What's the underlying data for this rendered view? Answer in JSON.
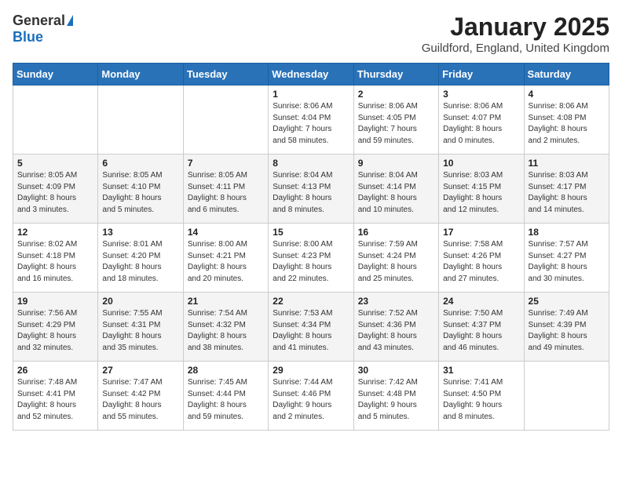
{
  "header": {
    "logo_general": "General",
    "logo_blue": "Blue",
    "month": "January 2025",
    "location": "Guildford, England, United Kingdom"
  },
  "days_of_week": [
    "Sunday",
    "Monday",
    "Tuesday",
    "Wednesday",
    "Thursday",
    "Friday",
    "Saturday"
  ],
  "weeks": [
    [
      {
        "day": "",
        "info": ""
      },
      {
        "day": "",
        "info": ""
      },
      {
        "day": "",
        "info": ""
      },
      {
        "day": "1",
        "info": "Sunrise: 8:06 AM\nSunset: 4:04 PM\nDaylight: 7 hours\nand 58 minutes."
      },
      {
        "day": "2",
        "info": "Sunrise: 8:06 AM\nSunset: 4:05 PM\nDaylight: 7 hours\nand 59 minutes."
      },
      {
        "day": "3",
        "info": "Sunrise: 8:06 AM\nSunset: 4:07 PM\nDaylight: 8 hours\nand 0 minutes."
      },
      {
        "day": "4",
        "info": "Sunrise: 8:06 AM\nSunset: 4:08 PM\nDaylight: 8 hours\nand 2 minutes."
      }
    ],
    [
      {
        "day": "5",
        "info": "Sunrise: 8:05 AM\nSunset: 4:09 PM\nDaylight: 8 hours\nand 3 minutes."
      },
      {
        "day": "6",
        "info": "Sunrise: 8:05 AM\nSunset: 4:10 PM\nDaylight: 8 hours\nand 5 minutes."
      },
      {
        "day": "7",
        "info": "Sunrise: 8:05 AM\nSunset: 4:11 PM\nDaylight: 8 hours\nand 6 minutes."
      },
      {
        "day": "8",
        "info": "Sunrise: 8:04 AM\nSunset: 4:13 PM\nDaylight: 8 hours\nand 8 minutes."
      },
      {
        "day": "9",
        "info": "Sunrise: 8:04 AM\nSunset: 4:14 PM\nDaylight: 8 hours\nand 10 minutes."
      },
      {
        "day": "10",
        "info": "Sunrise: 8:03 AM\nSunset: 4:15 PM\nDaylight: 8 hours\nand 12 minutes."
      },
      {
        "day": "11",
        "info": "Sunrise: 8:03 AM\nSunset: 4:17 PM\nDaylight: 8 hours\nand 14 minutes."
      }
    ],
    [
      {
        "day": "12",
        "info": "Sunrise: 8:02 AM\nSunset: 4:18 PM\nDaylight: 8 hours\nand 16 minutes."
      },
      {
        "day": "13",
        "info": "Sunrise: 8:01 AM\nSunset: 4:20 PM\nDaylight: 8 hours\nand 18 minutes."
      },
      {
        "day": "14",
        "info": "Sunrise: 8:00 AM\nSunset: 4:21 PM\nDaylight: 8 hours\nand 20 minutes."
      },
      {
        "day": "15",
        "info": "Sunrise: 8:00 AM\nSunset: 4:23 PM\nDaylight: 8 hours\nand 22 minutes."
      },
      {
        "day": "16",
        "info": "Sunrise: 7:59 AM\nSunset: 4:24 PM\nDaylight: 8 hours\nand 25 minutes."
      },
      {
        "day": "17",
        "info": "Sunrise: 7:58 AM\nSunset: 4:26 PM\nDaylight: 8 hours\nand 27 minutes."
      },
      {
        "day": "18",
        "info": "Sunrise: 7:57 AM\nSunset: 4:27 PM\nDaylight: 8 hours\nand 30 minutes."
      }
    ],
    [
      {
        "day": "19",
        "info": "Sunrise: 7:56 AM\nSunset: 4:29 PM\nDaylight: 8 hours\nand 32 minutes."
      },
      {
        "day": "20",
        "info": "Sunrise: 7:55 AM\nSunset: 4:31 PM\nDaylight: 8 hours\nand 35 minutes."
      },
      {
        "day": "21",
        "info": "Sunrise: 7:54 AM\nSunset: 4:32 PM\nDaylight: 8 hours\nand 38 minutes."
      },
      {
        "day": "22",
        "info": "Sunrise: 7:53 AM\nSunset: 4:34 PM\nDaylight: 8 hours\nand 41 minutes."
      },
      {
        "day": "23",
        "info": "Sunrise: 7:52 AM\nSunset: 4:36 PM\nDaylight: 8 hours\nand 43 minutes."
      },
      {
        "day": "24",
        "info": "Sunrise: 7:50 AM\nSunset: 4:37 PM\nDaylight: 8 hours\nand 46 minutes."
      },
      {
        "day": "25",
        "info": "Sunrise: 7:49 AM\nSunset: 4:39 PM\nDaylight: 8 hours\nand 49 minutes."
      }
    ],
    [
      {
        "day": "26",
        "info": "Sunrise: 7:48 AM\nSunset: 4:41 PM\nDaylight: 8 hours\nand 52 minutes."
      },
      {
        "day": "27",
        "info": "Sunrise: 7:47 AM\nSunset: 4:42 PM\nDaylight: 8 hours\nand 55 minutes."
      },
      {
        "day": "28",
        "info": "Sunrise: 7:45 AM\nSunset: 4:44 PM\nDaylight: 8 hours\nand 59 minutes."
      },
      {
        "day": "29",
        "info": "Sunrise: 7:44 AM\nSunset: 4:46 PM\nDaylight: 9 hours\nand 2 minutes."
      },
      {
        "day": "30",
        "info": "Sunrise: 7:42 AM\nSunset: 4:48 PM\nDaylight: 9 hours\nand 5 minutes."
      },
      {
        "day": "31",
        "info": "Sunrise: 7:41 AM\nSunset: 4:50 PM\nDaylight: 9 hours\nand 8 minutes."
      },
      {
        "day": "",
        "info": ""
      }
    ]
  ]
}
